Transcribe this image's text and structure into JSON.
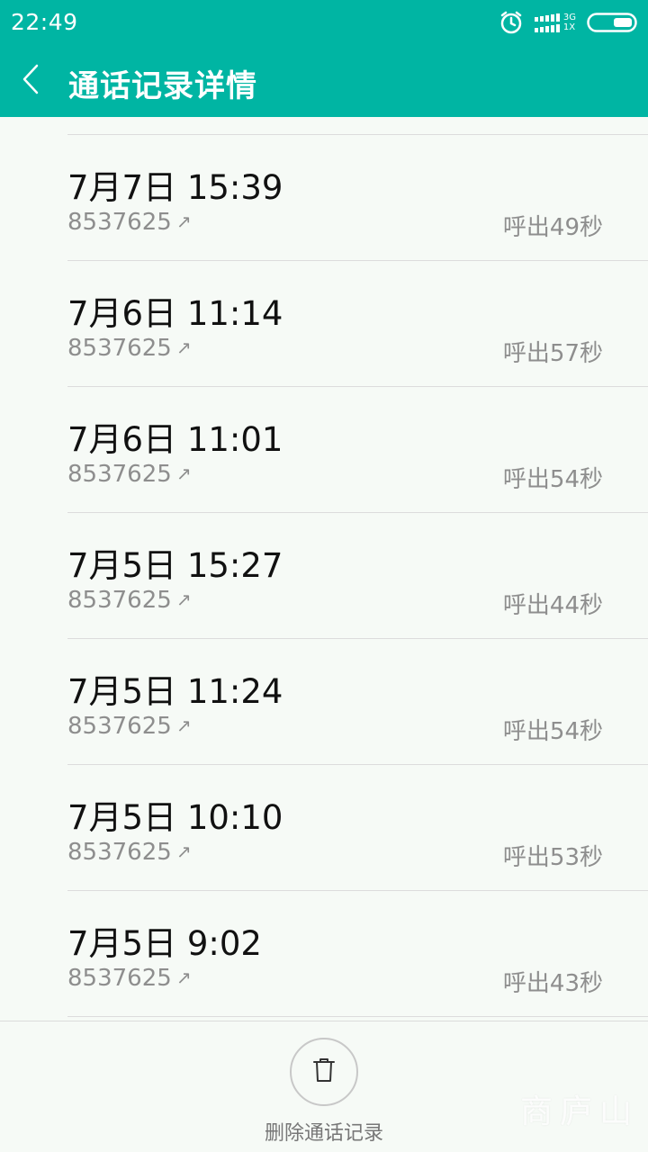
{
  "status_bar": {
    "time": "22:49",
    "network_top": "3G",
    "network_bottom": "1X",
    "icons": [
      "alarm-icon",
      "signal-icon",
      "battery-icon"
    ]
  },
  "app_bar": {
    "title": "通话记录详情",
    "back_icon": "chevron-left-icon"
  },
  "calls": [
    {
      "datetime": "7月7日 15:39",
      "number": "8537625",
      "direction_icon": "↗",
      "duration": "呼出49秒"
    },
    {
      "datetime": "7月6日 11:14",
      "number": "8537625",
      "direction_icon": "↗",
      "duration": "呼出57秒"
    },
    {
      "datetime": "7月6日 11:01",
      "number": "8537625",
      "direction_icon": "↗",
      "duration": "呼出54秒"
    },
    {
      "datetime": "7月5日 15:27",
      "number": "8537625",
      "direction_icon": "↗",
      "duration": "呼出44秒"
    },
    {
      "datetime": "7月5日 11:24",
      "number": "8537625",
      "direction_icon": "↗",
      "duration": "呼出54秒"
    },
    {
      "datetime": "7月5日 10:10",
      "number": "8537625",
      "direction_icon": "↗",
      "duration": "呼出53秒"
    },
    {
      "datetime": "7月5日 9:02",
      "number": "8537625",
      "direction_icon": "↗",
      "duration": "呼出43秒"
    }
  ],
  "bottom": {
    "delete_label": "删除通话记录",
    "delete_icon": "trash-icon"
  },
  "watermark": "商庐山",
  "colors": {
    "accent": "#00b5a3",
    "background": "#f6faf6",
    "primary_text": "#111111",
    "secondary_text": "#8e8e8e"
  }
}
